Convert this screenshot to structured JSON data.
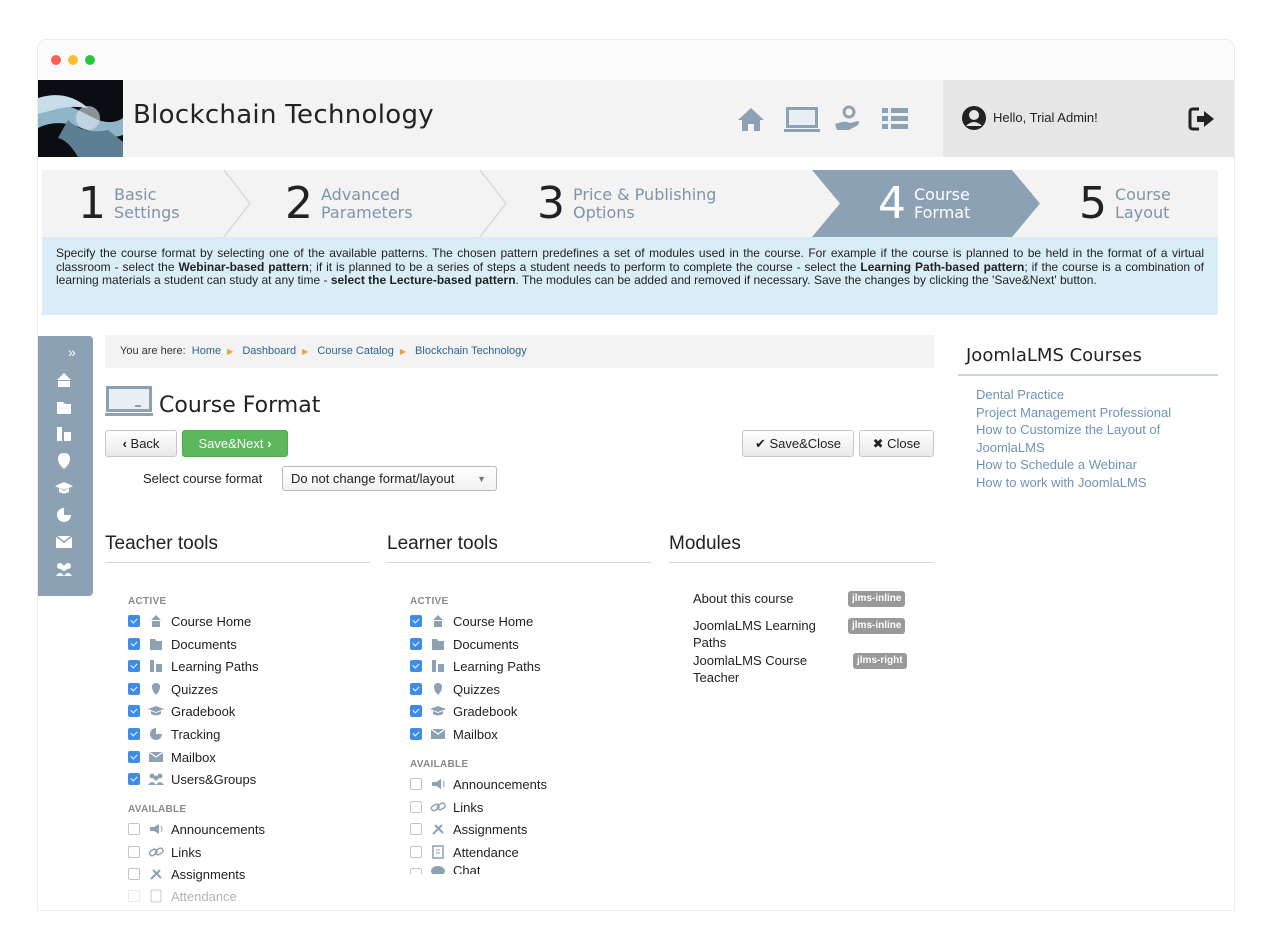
{
  "header": {
    "title": "Blockchain Technology",
    "greeting": "Hello, Trial Admin!"
  },
  "wizard": [
    {
      "num": "1",
      "line1": "Basic",
      "line2": "Settings"
    },
    {
      "num": "2",
      "line1": "Advanced",
      "line2": "Parameters"
    },
    {
      "num": "3",
      "line1": "Price & Publishing",
      "line2": "Options"
    },
    {
      "num": "4",
      "line1": "Course",
      "line2": "Format"
    },
    {
      "num": "5",
      "line1": "Course",
      "line2": "Layout"
    }
  ],
  "info": {
    "p1": "Specify the course format by selecting one of the available patterns. The chosen pattern predefines a set of modules used in the course. For example if the course is planned to be held in the format of a virtual classroom - select the ",
    "b1": "Webinar-based pattern",
    "p2": "; if it is planned to be a series of steps a student needs to perform to complete the course - select the ",
    "b2": "Learning Path-based pattern",
    "p3": "; if the course is a combination of learning materials a student can study at any time - ",
    "b3": "select the Lecture-based pattern",
    "p4": ". The modules can be added and removed if necessary. Save the changes by clicking the 'Save&Next' button."
  },
  "breadcrumb": {
    "prefix": "You are here:",
    "items": [
      "Home",
      "Dashboard",
      "Course Catalog",
      "Blockchain Technology"
    ]
  },
  "page": {
    "title": "Course Format",
    "back": "Back",
    "save_next": "Save&Next",
    "save_close": "Save&Close",
    "close": "Close",
    "format_label": "Select course format",
    "format_value": "Do not change format/layout"
  },
  "teacher": {
    "title": "Teacher tools",
    "active_label": "ACTIVE",
    "active": [
      "Course Home",
      "Documents",
      "Learning Paths",
      "Quizzes",
      "Gradebook",
      "Tracking",
      "Mailbox",
      "Users&Groups"
    ],
    "available_label": "AVAILABLE",
    "available": [
      "Announcements",
      "Links",
      "Assignments",
      "Attendance"
    ]
  },
  "learner": {
    "title": "Learner tools",
    "active_label": "ACTIVE",
    "active": [
      "Course Home",
      "Documents",
      "Learning Paths",
      "Quizzes",
      "Gradebook",
      "Mailbox"
    ],
    "available_label": "AVAILABLE",
    "available": [
      "Announcements",
      "Links",
      "Assignments",
      "Attendance",
      "Chat"
    ]
  },
  "modules": {
    "title": "Modules",
    "items": [
      {
        "l1": "About this course",
        "l2": "",
        "badge": "jlms-inline"
      },
      {
        "l1": "JoomlaLMS Learning",
        "l2": "Paths",
        "badge": "jlms-inline"
      },
      {
        "l1": "JoomlaLMS Course",
        "l2": "Teacher",
        "badge": "jlms-right"
      }
    ]
  },
  "sidebar_right": {
    "title": "JoomlaLMS Courses",
    "links": [
      "Dental Practice",
      "Project Management Professional",
      "How to Customize the Layout of",
      "JoomlaLMS",
      "How to Schedule a Webinar",
      "How to work with JoomlaLMS"
    ]
  },
  "colors": {
    "accent": "#8ca2b4",
    "green": "#5cb85c",
    "info_bg": "#d9edf7",
    "link": "#6e93b8"
  }
}
